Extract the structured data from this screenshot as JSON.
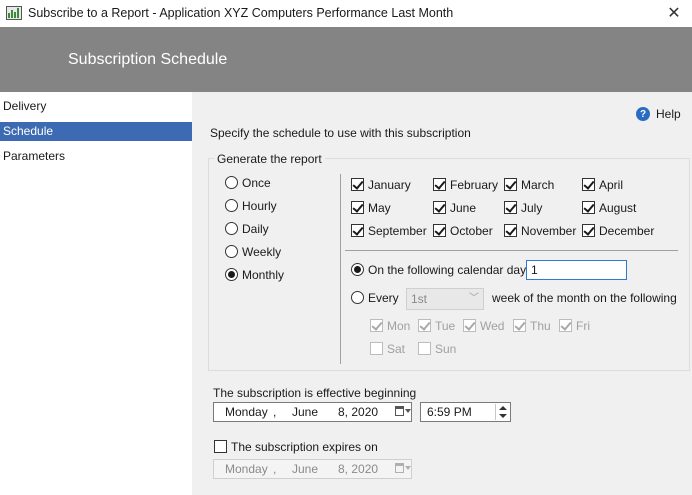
{
  "window": {
    "title": "Subscribe to a Report - Application XYZ Computers Performance Last Month",
    "close_glyph": "✕"
  },
  "banner": {
    "title": "Subscription Schedule"
  },
  "sidebar": {
    "items": [
      {
        "label": "Delivery",
        "selected": false
      },
      {
        "label": "Schedule",
        "selected": true
      },
      {
        "label": "Parameters",
        "selected": false
      }
    ]
  },
  "help": {
    "label": "Help",
    "glyph": "?"
  },
  "instruction": "Specify the schedule to use with this subscription",
  "generate": {
    "group_label": "Generate the report",
    "frequencies": [
      {
        "label": "Once",
        "selected": false
      },
      {
        "label": "Hourly",
        "selected": false
      },
      {
        "label": "Daily",
        "selected": false
      },
      {
        "label": "Weekly",
        "selected": false
      },
      {
        "label": "Monthly",
        "selected": true
      }
    ]
  },
  "months": [
    {
      "label": "January",
      "checked": true
    },
    {
      "label": "February",
      "checked": true
    },
    {
      "label": "March",
      "checked": true
    },
    {
      "label": "April",
      "checked": true
    },
    {
      "label": "May",
      "checked": true
    },
    {
      "label": "June",
      "checked": true
    },
    {
      "label": "July",
      "checked": true
    },
    {
      "label": "August",
      "checked": true
    },
    {
      "label": "September",
      "checked": true
    },
    {
      "label": "October",
      "checked": true
    },
    {
      "label": "November",
      "checked": true
    },
    {
      "label": "December",
      "checked": true
    }
  ],
  "calendar_days": {
    "label": "On the following calendar days",
    "selected": true,
    "value": "1"
  },
  "every": {
    "label": "Every",
    "selected": false,
    "week_value": "1st",
    "suffix": "week of the month on the following day"
  },
  "weekdays": [
    {
      "label": "Mon",
      "checked": true
    },
    {
      "label": "Tue",
      "checked": true
    },
    {
      "label": "Wed",
      "checked": true
    },
    {
      "label": "Thu",
      "checked": true
    },
    {
      "label": "Fri",
      "checked": true
    },
    {
      "label": "Sat",
      "checked": false
    },
    {
      "label": "Sun",
      "checked": false
    }
  ],
  "effective": {
    "label": "The subscription is effective beginning",
    "weekday": "Monday",
    "sep": ",",
    "month": "June",
    "day_year": "8, 2020",
    "time": "6:59 PM"
  },
  "expires": {
    "label": "The subscription expires on",
    "checked": false,
    "weekday": "Monday",
    "sep": ",",
    "month": "June",
    "day_year": "8, 2020"
  },
  "colors": {
    "banner": "#848484",
    "selected_nav": "#3d6bb3",
    "focus_border": "#2a7ad6"
  }
}
